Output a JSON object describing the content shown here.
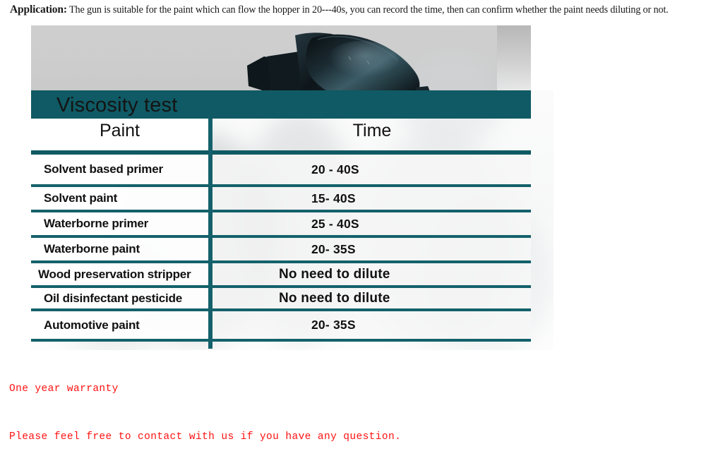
{
  "application_note": {
    "label": "Application:",
    "text": " The gun is  suitable for the paint which can flow the hopper in 20---40s, you can record the time, then can confirm whether the paint needs diluting or not."
  },
  "colors": {
    "teal": "#0f5a64",
    "teal_border": "#14616b",
    "red": "#ff1111",
    "photo_grey": "#cccccc"
  },
  "table": {
    "title": "Viscosity test",
    "columns": [
      {
        "label": "Paint"
      },
      {
        "label": "Time"
      }
    ],
    "rows": [
      {
        "paint": "Solvent based primer",
        "time": "20 - 40S"
      },
      {
        "paint": "Solvent paint",
        "time": "15- 40S"
      },
      {
        "paint": "Waterborne primer",
        "time": "25 - 40S"
      },
      {
        "paint": "Waterborne paint",
        "time": "20- 35S"
      },
      {
        "paint": "Wood preservation stripper",
        "time": "No need to dilute"
      },
      {
        "paint": "Oil disinfectant pesticide",
        "time": "No need to dilute"
      },
      {
        "paint": "Automotive paint",
        "time": "20- 35S"
      }
    ]
  },
  "photo": {
    "object_name": "viscosity-cup-funnel"
  },
  "notes": {
    "warranty": "One year warranty",
    "contact": "Please feel free to contact with us if you have any question."
  }
}
